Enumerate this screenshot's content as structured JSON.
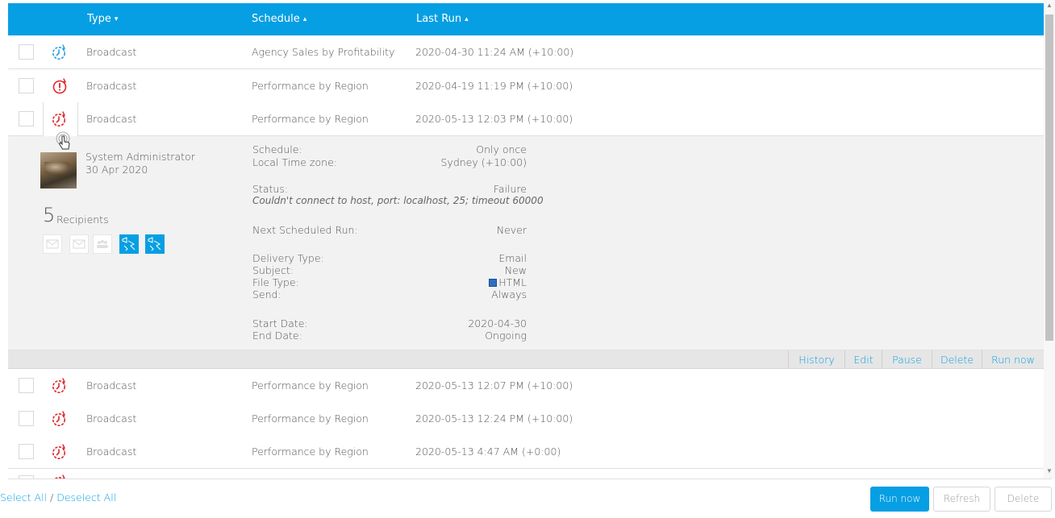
{
  "header": {
    "type_label": "Type",
    "type_sort": "▾",
    "schedule_label": "Schedule",
    "schedule_sort": "▴",
    "lastrun_label": "Last Run",
    "lastrun_sort": "▴"
  },
  "rows": [
    {
      "type": "Broadcast",
      "schedule": "Agency Sales by Profitability",
      "last_run": "2020-04-30 11:24 AM (+10:00)",
      "status_icon": "schedule-ok-icon"
    },
    {
      "type": "Broadcast",
      "schedule": "Performance by Region",
      "last_run": "2020-04-19 11:19 PM (+10:00)",
      "status_icon": "alert-icon"
    },
    {
      "type": "Broadcast",
      "schedule": "Performance by Region",
      "last_run": "2020-05-13 12:03 PM (+10:00)",
      "status_icon": "schedule-failed-icon"
    },
    {
      "type": "Broadcast",
      "schedule": "Performance by Region",
      "last_run": "2020-05-13 12:07 PM (+10:00)",
      "status_icon": "schedule-failed-icon"
    },
    {
      "type": "Broadcast",
      "schedule": "Performance by Region",
      "last_run": "2020-05-13 12:24 PM (+10:00)",
      "status_icon": "schedule-failed-icon"
    },
    {
      "type": "Broadcast",
      "schedule": "Performance by Region",
      "last_run": "2020-05-13 4:47 AM (+0:00)",
      "status_icon": "schedule-failed-icon"
    }
  ],
  "detail": {
    "creator_name": "System Administrator",
    "created_date": "30 Apr 2020",
    "recipient_count": "5",
    "recipient_label": "Recipients",
    "schedule_key": "Schedule:",
    "schedule_val": "Only once",
    "timezone_key": "Local Time zone:",
    "timezone_val": "Sydney (+10:00)",
    "status_key": "Status:",
    "status_val": "Failure",
    "status_msg": "Couldn't connect to host, port: localhost, 25; timeout 60000",
    "next_key": "Next Scheduled Run:",
    "next_val": "Never",
    "delivery_key": "Delivery Type:",
    "delivery_val": "Email",
    "subject_key": "Subject:",
    "subject_val": "New",
    "filetype_key": "File Type:",
    "filetype_val": "HTML",
    "send_key": "Send:",
    "send_val": "Always",
    "start_key": "Start Date:",
    "start_val": "2020-04-30",
    "end_key": "End Date:",
    "end_val": "Ongoing"
  },
  "actions": {
    "history": "History",
    "edit": "Edit",
    "pause": "Pause",
    "delete": "Delete",
    "run_now": "Run now"
  },
  "footer": {
    "select_all": "Select All",
    "separator": " / ",
    "deselect_all": "Deselect All",
    "run_now": "Run now",
    "refresh": "Refresh",
    "delete": "Delete"
  },
  "colors": {
    "accent": "#069fe3",
    "ok_icon": "#2aa0e0",
    "fail_icon": "#e0262b"
  }
}
